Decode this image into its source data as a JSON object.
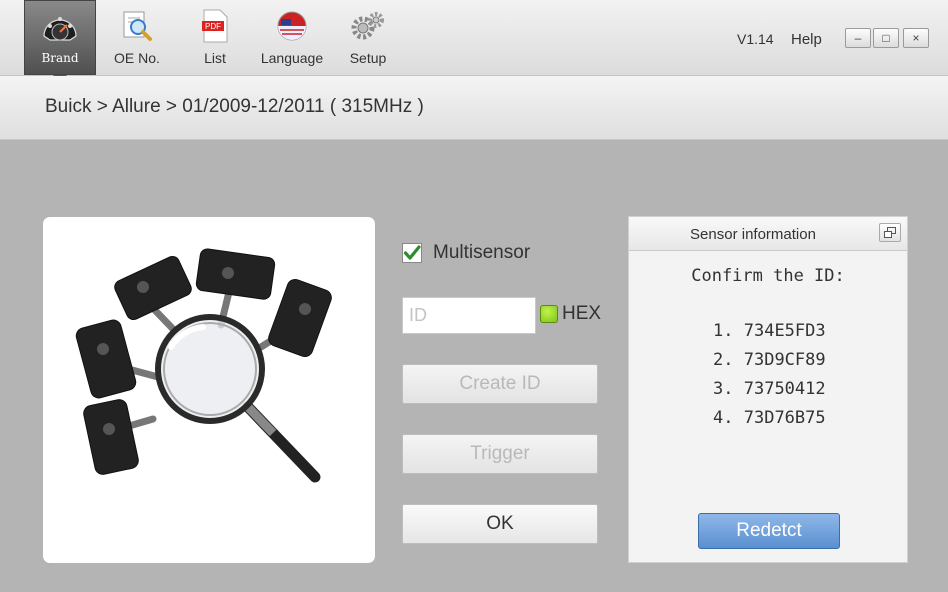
{
  "toolbar": {
    "items": [
      {
        "label": "Brand",
        "icon": "dashboard-gauge-icon"
      },
      {
        "label": "OE No.",
        "icon": "magnifier-document-icon"
      },
      {
        "label": "List",
        "icon": "pdf-file-icon"
      },
      {
        "label": "Language",
        "icon": "flag-icon"
      },
      {
        "label": "Setup",
        "icon": "gears-icon"
      }
    ],
    "active": "Brand",
    "version": "V1.14",
    "help": "Help"
  },
  "window_controls": {
    "minimize": "–",
    "maximize": "□",
    "close": "×"
  },
  "breadcrumb": "Buick > Allure > 01/2009-12/2011 ( 315MHz )",
  "image_panel": {
    "icon": "tpms-sensors-magnifier-image"
  },
  "controls": {
    "multisensor_label": "Multisensor",
    "multisensor_checked": true,
    "id_placeholder": "ID",
    "id_value": "",
    "hex_label": "HEX",
    "hex_checked": true,
    "create_id_label": "Create ID",
    "trigger_label": "Trigger",
    "ok_label": "OK"
  },
  "sensor_panel": {
    "title": "Sensor information",
    "confirm_text": "Confirm the ID:",
    "ids": [
      {
        "num": "1.",
        "id": "734E5FD3"
      },
      {
        "num": "2.",
        "id": "73D9CF89"
      },
      {
        "num": "3.",
        "id": "73750412"
      },
      {
        "num": "4.",
        "id": "73D76B75"
      }
    ],
    "redetect_label": "Redetct"
  },
  "colors": {
    "accent": "#5a8fd0",
    "check": "#2e8b2e",
    "hex_indicator": "#8fd62a"
  }
}
